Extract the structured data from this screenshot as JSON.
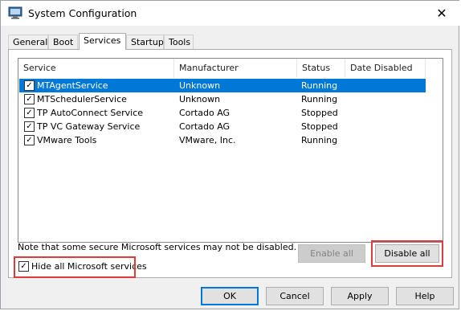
{
  "window": {
    "title": "System Configuration",
    "close_glyph": "✕",
    "app_icon": "system-config-icon"
  },
  "tabs": [
    {
      "label": "General"
    },
    {
      "label": "Boot"
    },
    {
      "label": "Services"
    },
    {
      "label": "Startup"
    },
    {
      "label": "Tools"
    }
  ],
  "active_tab": "Services",
  "services_table": {
    "columns": [
      "Service",
      "Manufacturer",
      "Status",
      "Date Disabled"
    ],
    "rows": [
      {
        "checked": true,
        "service": "MTAgentService",
        "manufacturer": "Unknown",
        "status": "Running",
        "date_disabled": "",
        "selected": true
      },
      {
        "checked": true,
        "service": "MTSchedulerService",
        "manufacturer": "Unknown",
        "status": "Running",
        "date_disabled": ""
      },
      {
        "checked": true,
        "service": "TP AutoConnect Service",
        "manufacturer": "Cortado AG",
        "status": "Stopped",
        "date_disabled": ""
      },
      {
        "checked": true,
        "service": "TP VC Gateway Service",
        "manufacturer": "Cortado AG",
        "status": "Stopped",
        "date_disabled": ""
      },
      {
        "checked": true,
        "service": "VMware Tools",
        "manufacturer": "VMware, Inc.",
        "status": "Running",
        "date_disabled": ""
      }
    ]
  },
  "note": "Note that some secure Microsoft services may not be disabled.",
  "buttons": {
    "enable_all": "Enable all",
    "disable_all": "Disable all",
    "ok": "OK",
    "cancel": "Cancel",
    "apply": "Apply",
    "help": "Help"
  },
  "hide_ms": {
    "label": "Hide all Microsoft services",
    "checked": true
  },
  "check_glyph": "✓",
  "colors": {
    "selection": "#0078d7",
    "highlight_box": "#e03a3a"
  }
}
